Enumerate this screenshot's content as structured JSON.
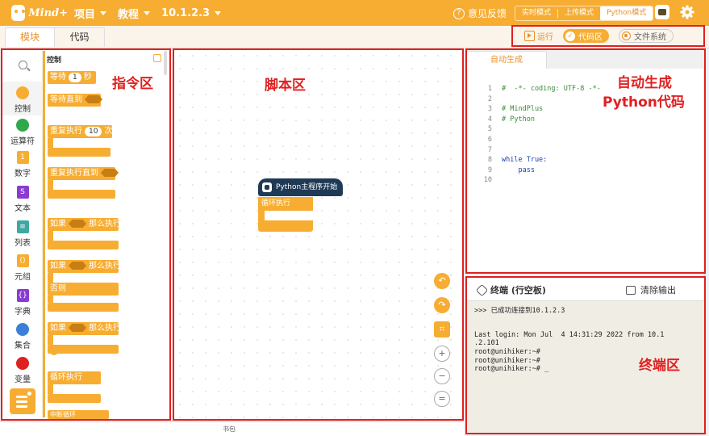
{
  "app": {
    "logo_text": "Mind+",
    "menu": [
      {
        "label": "项目"
      },
      {
        "label": "教程"
      },
      {
        "label": "10.1.2.3"
      }
    ],
    "feedback": "意见反馈",
    "modes": [
      "实时模式",
      "上传模式",
      "Python模式"
    ],
    "active_mode": "Python模式"
  },
  "subbar": {
    "tabs": [
      "模块",
      "代码"
    ],
    "active_tab": "模块",
    "run": "运行",
    "code_area": "代码区",
    "file_system": "文件系统"
  },
  "categories": [
    {
      "label": "控制",
      "color": "#f7ad32"
    },
    {
      "label": "运算符",
      "color": "#2ea84a"
    },
    {
      "label": "数字",
      "color": "#f7ad32"
    },
    {
      "label": "文本",
      "color": "#8a3bd1"
    },
    {
      "label": "列表",
      "color": "#3fa8a0"
    },
    {
      "label": "元组",
      "color": "#f7ad32"
    },
    {
      "label": "字典",
      "color": "#8a3bd1"
    },
    {
      "label": "集合",
      "color": "#3a80d8"
    },
    {
      "label": "变量",
      "color": "#e02020"
    }
  ],
  "palette": {
    "title": "控制",
    "wait": "等待",
    "wait_value": "1",
    "wait_unit": "秒",
    "wait_until": "等待直到",
    "repeat": "重复执行",
    "repeat_value": "10",
    "repeat_unit": "次",
    "repeat_until": "重复执行直到",
    "if": "如果",
    "then": "那么执行",
    "else": "否则",
    "loop": "循环执行",
    "break": "中断循环"
  },
  "script": {
    "hat": "Python主程序开始",
    "loop": "循环执行"
  },
  "code": {
    "tab": "自动生成",
    "lines": [
      {
        "n": "1",
        "text": "#  -*- coding: UTF-8 -*-",
        "kind": "com"
      },
      {
        "n": "2",
        "text": "",
        "kind": ""
      },
      {
        "n": "3",
        "text": "# MindPlus",
        "kind": "com"
      },
      {
        "n": "4",
        "text": "# Python",
        "kind": "com"
      },
      {
        "n": "5",
        "text": "",
        "kind": ""
      },
      {
        "n": "6",
        "text": "",
        "kind": ""
      },
      {
        "n": "7",
        "text": "",
        "kind": ""
      },
      {
        "n": "8",
        "text": "while True:",
        "kind": "kw"
      },
      {
        "n": "9",
        "text": "    pass",
        "kind": "kw"
      },
      {
        "n": "10",
        "text": "",
        "kind": ""
      }
    ]
  },
  "terminal": {
    "title": "终端 (行空板)",
    "clear": "清除输出",
    "lines": [
      ">>> 已成功连接到10.1.2.3",
      "",
      "",
      "Last login: Mon Jul  4 14:31:29 2022 from 10.1",
      ".2.101",
      "root@unihiker:~#",
      "root@unihiker:~#",
      "root@unihiker:~# _"
    ]
  },
  "statusbar": {
    "text": "书包"
  },
  "annotations": {
    "palette_label": "指令区",
    "script_label": "脚本区",
    "code_label_1": "自动生成",
    "code_label_2": "Python代码",
    "terminal_label": "终端区"
  }
}
